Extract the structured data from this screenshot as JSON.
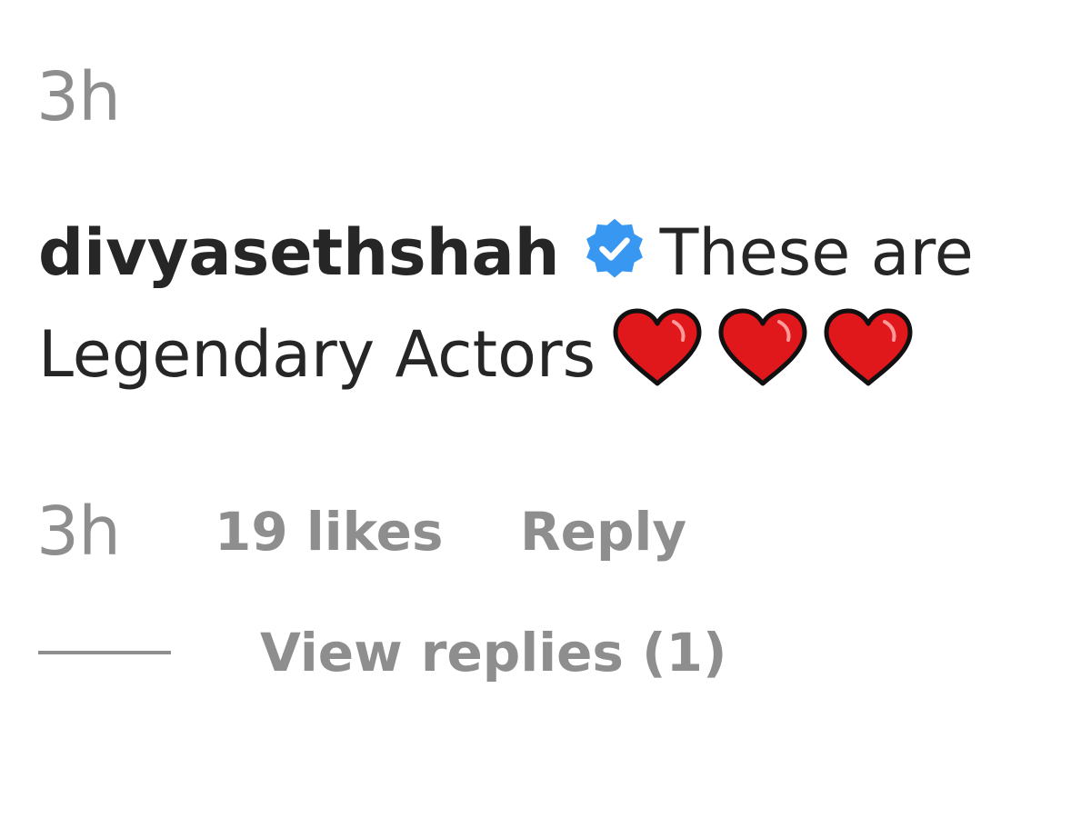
{
  "previous_comment": {
    "timestamp": "3h"
  },
  "comment": {
    "username": "divyasethshah",
    "verified": true,
    "text": "These are Legendary Actors",
    "emoji": [
      "heart-emoji",
      "heart-emoji",
      "heart-emoji"
    ],
    "timestamp": "3h",
    "likes_label": "19 likes",
    "reply_label": "Reply",
    "view_replies_label": "View replies (1)"
  },
  "colors": {
    "text": "#262626",
    "secondary": "#8e8e8e",
    "verified_blue": "#3897f0",
    "heart_red": "#e0171b"
  }
}
